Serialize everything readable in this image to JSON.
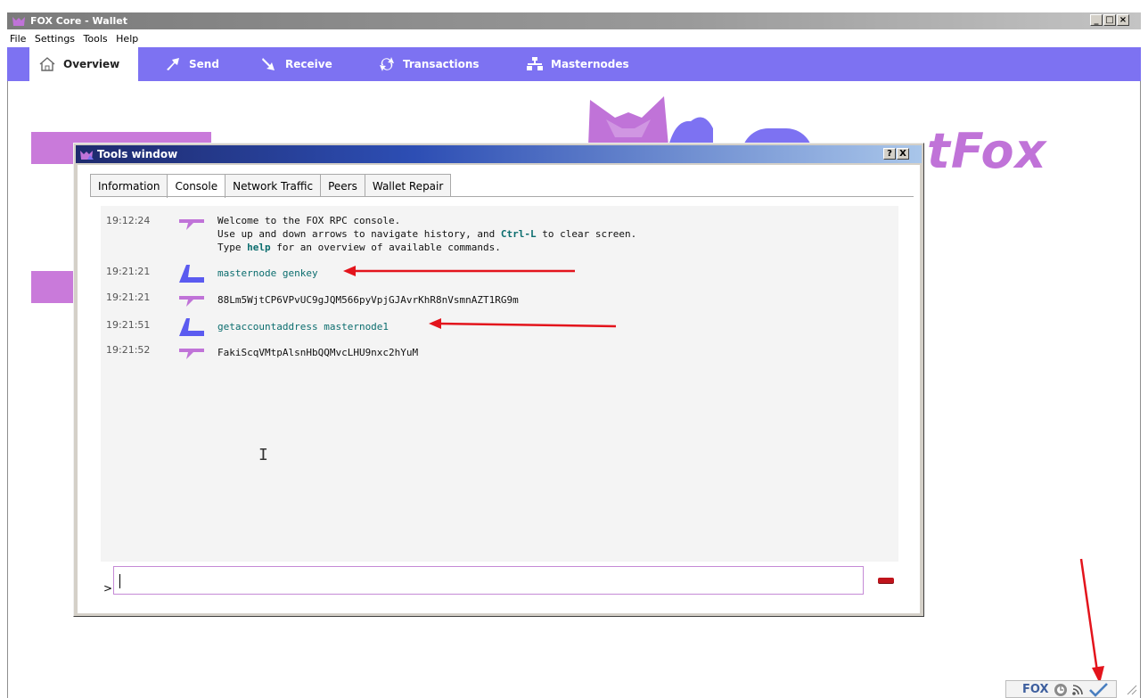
{
  "window": {
    "title": "FOX Core - Wallet"
  },
  "menu": {
    "items": [
      "File",
      "Settings",
      "Tools",
      "Help"
    ]
  },
  "nav": {
    "tabs": [
      {
        "label": "Overview",
        "icon": "home-icon",
        "active": true
      },
      {
        "label": "Send",
        "icon": "send-arrow-icon",
        "active": false
      },
      {
        "label": "Receive",
        "icon": "receive-arrow-icon",
        "active": false
      },
      {
        "label": "Transactions",
        "icon": "transactions-icon",
        "active": false
      },
      {
        "label": "Masternodes",
        "icon": "masternodes-icon",
        "active": false
      }
    ]
  },
  "logo": {
    "text": "tFox"
  },
  "tools_window": {
    "title": "Tools window",
    "help_button": "?",
    "close_button": "X",
    "tabs": [
      {
        "label": "Information",
        "active": false
      },
      {
        "label": "Console",
        "active": true
      },
      {
        "label": "Network Traffic",
        "active": false
      },
      {
        "label": "Peers",
        "active": false
      },
      {
        "label": "Wallet Repair",
        "active": false
      }
    ],
    "console": {
      "welcome_time": "19:12:24",
      "welcome_line1": "Welcome to the FOX RPC console.",
      "welcome_line2a": "Use up and down arrows to navigate history, and ",
      "welcome_line2b": "Ctrl-L",
      "welcome_line2c": " to clear screen.",
      "welcome_line3a": "Type ",
      "welcome_line3b": "help",
      "welcome_line3c": " for an overview of available commands.",
      "entries": [
        {
          "time": "19:21:21",
          "kind": "command",
          "text": "masternode genkey"
        },
        {
          "time": "19:21:21",
          "kind": "reply",
          "text": "88Lm5WjtCP6VPvUC9gJQM566pyVpjGJAvrKhR8nVsmnAZT1RG9m"
        },
        {
          "time": "19:21:51",
          "kind": "command",
          "text": "getaccountaddress masternode1"
        },
        {
          "time": "19:21:52",
          "kind": "reply",
          "text": "FakiScqVMtpAlsnHbQQMvcLHU9nxc2hYuM"
        }
      ],
      "prompt": ">",
      "input_value": ""
    }
  },
  "status_bar": {
    "label": "FOX",
    "icons": [
      "sync-icon",
      "network-icon",
      "synced-check-icon"
    ]
  },
  "colors": {
    "nav_bg": "#7d72f2",
    "brand_purple": "#c073d8",
    "annotation_red": "#e3141c",
    "console_cmd": "#0b6d6e"
  }
}
